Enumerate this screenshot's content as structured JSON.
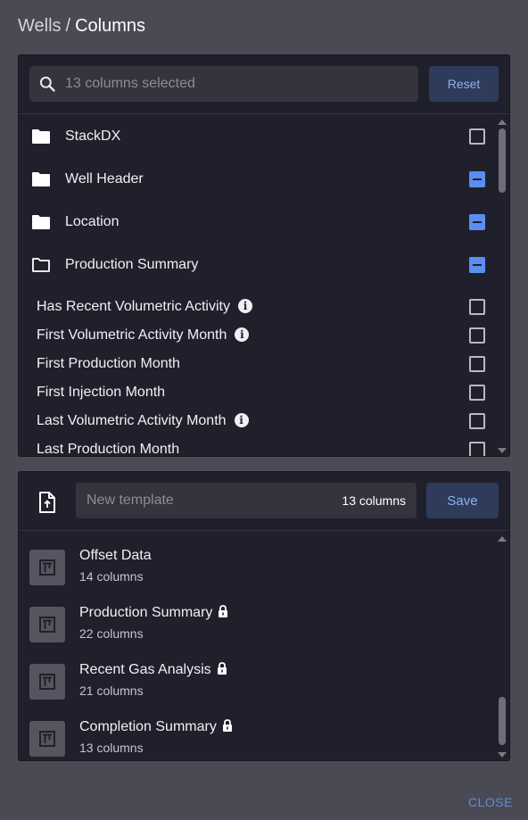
{
  "header": {
    "breadcrumb_parent": "Wells",
    "separator": "/",
    "current": "Columns"
  },
  "search": {
    "placeholder": "13 columns selected",
    "value": ""
  },
  "reset_label": "Reset",
  "folders": [
    {
      "label": "StackDX",
      "state": "unchecked",
      "icon": "folder-filled-icon"
    },
    {
      "label": "Well Header",
      "state": "partial",
      "icon": "folder-filled-icon"
    },
    {
      "label": "Location",
      "state": "partial",
      "icon": "folder-filled-icon"
    },
    {
      "label": "Production Summary",
      "state": "partial",
      "icon": "folder-open-icon"
    }
  ],
  "columns": [
    {
      "label": "Has Recent Volumetric Activity",
      "info": true,
      "state": "unchecked"
    },
    {
      "label": "First Volumetric Activity Month",
      "info": true,
      "state": "unchecked"
    },
    {
      "label": "First Production Month",
      "info": false,
      "state": "unchecked"
    },
    {
      "label": "First Injection Month",
      "info": false,
      "state": "unchecked"
    },
    {
      "label": "Last Volumetric Activity Month",
      "info": true,
      "state": "unchecked"
    },
    {
      "label": "Last Production Month",
      "info": false,
      "state": "unchecked"
    }
  ],
  "template": {
    "placeholder": "New template",
    "value": "",
    "count": "13 columns",
    "save_label": "Save"
  },
  "templates": [
    {
      "name": "Offset Data",
      "count": "14 columns",
      "locked": false
    },
    {
      "name": "Production Summary",
      "count": "22 columns",
      "locked": true
    },
    {
      "name": "Recent Gas Analysis",
      "count": "21 columns",
      "locked": true
    },
    {
      "name": "Completion Summary",
      "count": "13 columns",
      "locked": true
    }
  ],
  "close_label": "CLOSE",
  "colors": {
    "background": "#4a4a55",
    "panel": "#20202c",
    "accent": "#5b8ef0",
    "button": "#2e3b5a"
  }
}
